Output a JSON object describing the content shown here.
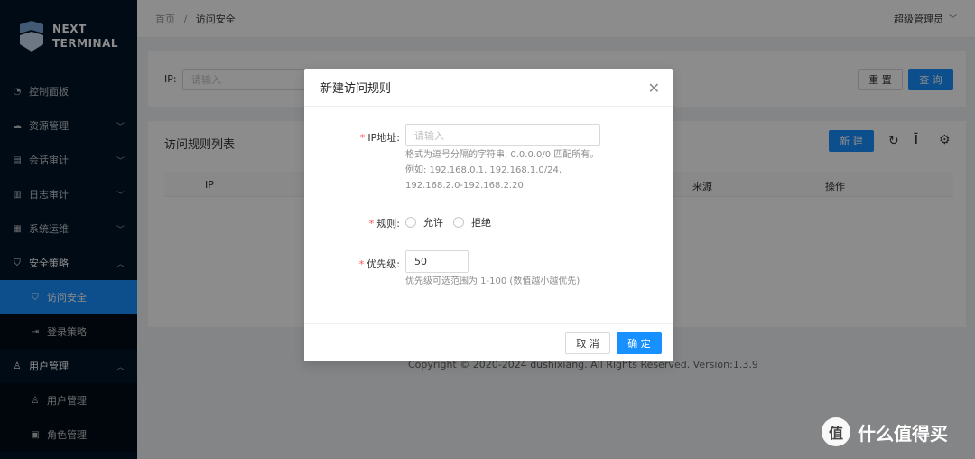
{
  "brand": {
    "line1": "NEXT",
    "line2": "TERMINAL"
  },
  "sidebar": {
    "items": [
      {
        "label": "控制面板",
        "icon": "dashboard-icon"
      },
      {
        "label": "资源管理",
        "icon": "cloud-icon"
      },
      {
        "label": "会话审计",
        "icon": "audit-icon"
      },
      {
        "label": "日志审计",
        "icon": "log-icon"
      },
      {
        "label": "系统运维",
        "icon": "ops-icon"
      },
      {
        "label": "安全策略",
        "icon": "shield-icon"
      },
      {
        "label": "访问安全",
        "icon": "shield-check-icon"
      },
      {
        "label": "登录策略",
        "icon": "login-icon"
      },
      {
        "label": "用户管理",
        "icon": "user-icon"
      },
      {
        "label": "用户管理",
        "icon": "user-icon"
      },
      {
        "label": "角色管理",
        "icon": "role-icon"
      }
    ]
  },
  "header": {
    "breadcrumb": [
      "首页",
      "访问安全"
    ],
    "user": "超级管理员"
  },
  "search": {
    "ip_label": "IP:",
    "ip_placeholder": "请输入",
    "reset_label": "重 置",
    "query_label": "查 询"
  },
  "list": {
    "title": "访问规则列表",
    "new_label": "新 建",
    "columns": [
      "IP",
      "来源",
      "操作"
    ]
  },
  "footer": "Copyright © 2020-2024 dushixiang. All Rights Reserved. Version:1.3.9",
  "modal": {
    "title": "新建访问规则",
    "ip_label": "IP地址:",
    "ip_placeholder": "请输入",
    "ip_help": "格式为逗号分隔的字符串, 0.0.0.0/0 匹配所有。例如: 192.168.0.1, 192.168.1.0/24, 192.168.2.0-192.168.2.20",
    "rule_label": "规则:",
    "rule_options": [
      "允许",
      "拒绝"
    ],
    "priority_label": "优先级:",
    "priority_value": "50",
    "priority_help": "优先级可选范围为 1-100 (数值越小越优先)",
    "cancel_label": "取 消",
    "ok_label": "确 定"
  },
  "watermark": "什么值得买",
  "colors": {
    "primary": "#1890ff",
    "sidebar": "#001529",
    "required": "#ff4d4f"
  }
}
